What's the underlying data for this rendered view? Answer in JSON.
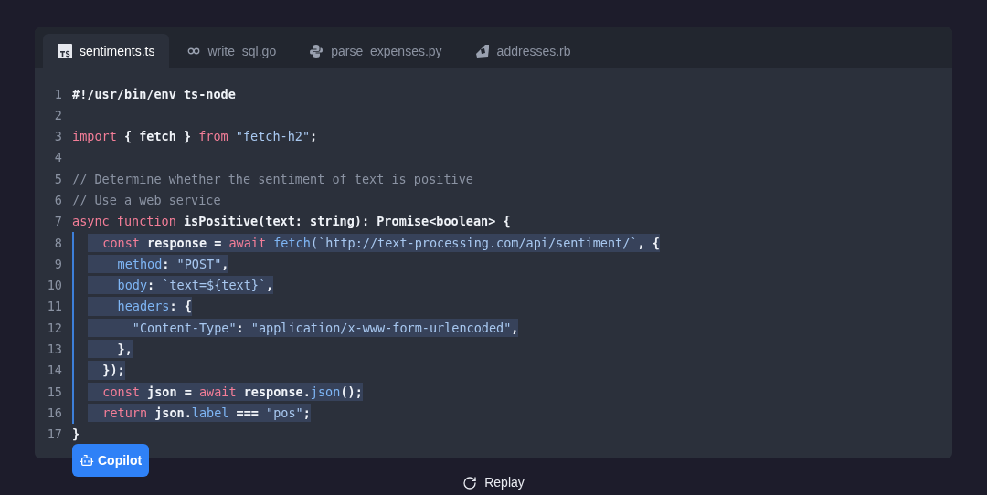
{
  "tabs": [
    {
      "label": "sentiments.ts",
      "kind": "ts",
      "selected": true
    },
    {
      "label": "write_sql.go",
      "kind": "go",
      "selected": false
    },
    {
      "label": "parse_expenses.py",
      "kind": "py",
      "selected": false
    },
    {
      "label": "addresses.rb",
      "kind": "rb",
      "selected": false
    }
  ],
  "lines": [
    {
      "number": "1",
      "suggested": false,
      "tokens": [
        {
          "kind": "plain",
          "text": "#!/usr/bin/env ts-node"
        }
      ]
    },
    {
      "number": "2",
      "suggested": false
    },
    {
      "number": "3",
      "suggested": false,
      "tokens": [
        {
          "kind": "kw",
          "text": "import"
        },
        {
          "kind": "plain",
          "text": " { fetch } "
        },
        {
          "kind": "kw",
          "text": "from"
        },
        {
          "kind": "str",
          "text": " \"fetch-h2\""
        },
        {
          "kind": "plain",
          "text": ";"
        }
      ]
    },
    {
      "number": "4",
      "suggested": false
    },
    {
      "number": "5",
      "suggested": false,
      "tokens": [
        {
          "kind": "com",
          "text": "// Determine whether the sentiment of text is positive"
        }
      ]
    },
    {
      "number": "6",
      "suggested": false,
      "tokens": [
        {
          "kind": "com",
          "text": "// Use a web service"
        }
      ]
    },
    {
      "number": "7",
      "suggested": false,
      "tokens": [
        {
          "kind": "kw",
          "text": "async function"
        },
        {
          "kind": "plain",
          "text": " isPositive(text: string): Promise<boolean> {"
        }
      ]
    },
    {
      "number": "8",
      "suggested": true,
      "tokens": [
        {
          "kind": "kw",
          "text": "  const"
        },
        {
          "kind": "plain",
          "text": " response = "
        },
        {
          "kind": "kw",
          "text": "await"
        },
        {
          "kind": "prop",
          "text": " fetch"
        },
        {
          "kind": "str",
          "text": "(`http://text-processing.com/api/sentiment/`"
        },
        {
          "kind": "plain",
          "text": ", {"
        }
      ]
    },
    {
      "number": "9",
      "suggested": true,
      "tokens": [
        {
          "kind": "prop",
          "text": "    method"
        },
        {
          "kind": "plain",
          "text": ": "
        },
        {
          "kind": "str",
          "text": "\"POST\""
        },
        {
          "kind": "plain",
          "text": ","
        }
      ]
    },
    {
      "number": "10",
      "suggested": true,
      "tokens": [
        {
          "kind": "prop",
          "text": "    body"
        },
        {
          "kind": "plain",
          "text": ": "
        },
        {
          "kind": "str",
          "text": "`text=${text}`"
        },
        {
          "kind": "plain",
          "text": ","
        }
      ]
    },
    {
      "number": "11",
      "suggested": true,
      "tokens": [
        {
          "kind": "prop",
          "text": "    headers"
        },
        {
          "kind": "plain",
          "text": ": {"
        }
      ]
    },
    {
      "number": "12",
      "suggested": true,
      "tokens": [
        {
          "kind": "str",
          "text": "      \"Content-Type\""
        },
        {
          "kind": "plain",
          "text": ": "
        },
        {
          "kind": "str",
          "text": "\"application/x-www-form-urlencoded\""
        },
        {
          "kind": "plain",
          "text": ","
        }
      ]
    },
    {
      "number": "13",
      "suggested": true,
      "tokens": [
        {
          "kind": "plain",
          "text": "    },"
        }
      ]
    },
    {
      "number": "14",
      "suggested": true,
      "tokens": [
        {
          "kind": "plain",
          "text": "  });"
        }
      ]
    },
    {
      "number": "15",
      "suggested": true,
      "tokens": [
        {
          "kind": "kw",
          "text": "  const"
        },
        {
          "kind": "plain",
          "text": " json = "
        },
        {
          "kind": "kw",
          "text": "await"
        },
        {
          "kind": "plain",
          "text": " response."
        },
        {
          "kind": "prop",
          "text": "json"
        },
        {
          "kind": "plain",
          "text": "();"
        }
      ]
    },
    {
      "number": "16",
      "suggested": true,
      "tokens": [
        {
          "kind": "kw",
          "text": "  return"
        },
        {
          "kind": "plain",
          "text": " json."
        },
        {
          "kind": "prop",
          "text": "label"
        },
        {
          "kind": "plain",
          "text": " === "
        },
        {
          "kind": "str",
          "text": "\"pos\""
        },
        {
          "kind": "plain",
          "text": ";"
        }
      ]
    },
    {
      "number": "17",
      "suggested": false,
      "tokens": [
        {
          "kind": "plain",
          "text": "}"
        }
      ]
    }
  ],
  "badge": "Copilot",
  "replay": "Replay"
}
